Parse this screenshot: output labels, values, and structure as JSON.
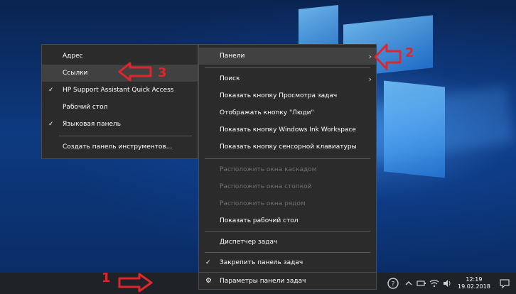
{
  "left_menu": {
    "items": [
      {
        "label": "Адрес",
        "checked": false
      },
      {
        "label": "Ссылки",
        "checked": false
      },
      {
        "label": "HP Support Assistant Quick Access",
        "checked": true
      },
      {
        "label": "Рабочий стол",
        "checked": false
      },
      {
        "label": "Языковая панель",
        "checked": true
      },
      {
        "label": "Создать панель инструментов...",
        "checked": false
      }
    ]
  },
  "right_menu": {
    "panels": "Панели",
    "search": "Поиск",
    "task_view": "Показать кнопку Просмотра задач",
    "people": "Отображать кнопку \"Люди\"",
    "ink": "Показать кнопку Windows Ink Workspace",
    "keyboard": "Показать кнопку сенсорной клавиатуры",
    "cascade": "Расположить окна каскадом",
    "stack": "Расположить окна стопкой",
    "side": "Расположить окна рядом",
    "desktop": "Показать рабочий стол",
    "task_manager": "Диспетчер задач",
    "lock": "Закрепить панель задач",
    "settings": "Параметры панели задач"
  },
  "annotations": {
    "one": "1",
    "two": "2",
    "three": "3"
  },
  "taskbar": {
    "time": "12:19",
    "date": "19.02.2018"
  },
  "icons": {
    "check": "✓",
    "chevron": "›",
    "gear": "⚙"
  },
  "colors": {
    "annotation": "#e0262b",
    "menu_bg": "#2b2b2b",
    "taskbar": "#1f2327"
  }
}
